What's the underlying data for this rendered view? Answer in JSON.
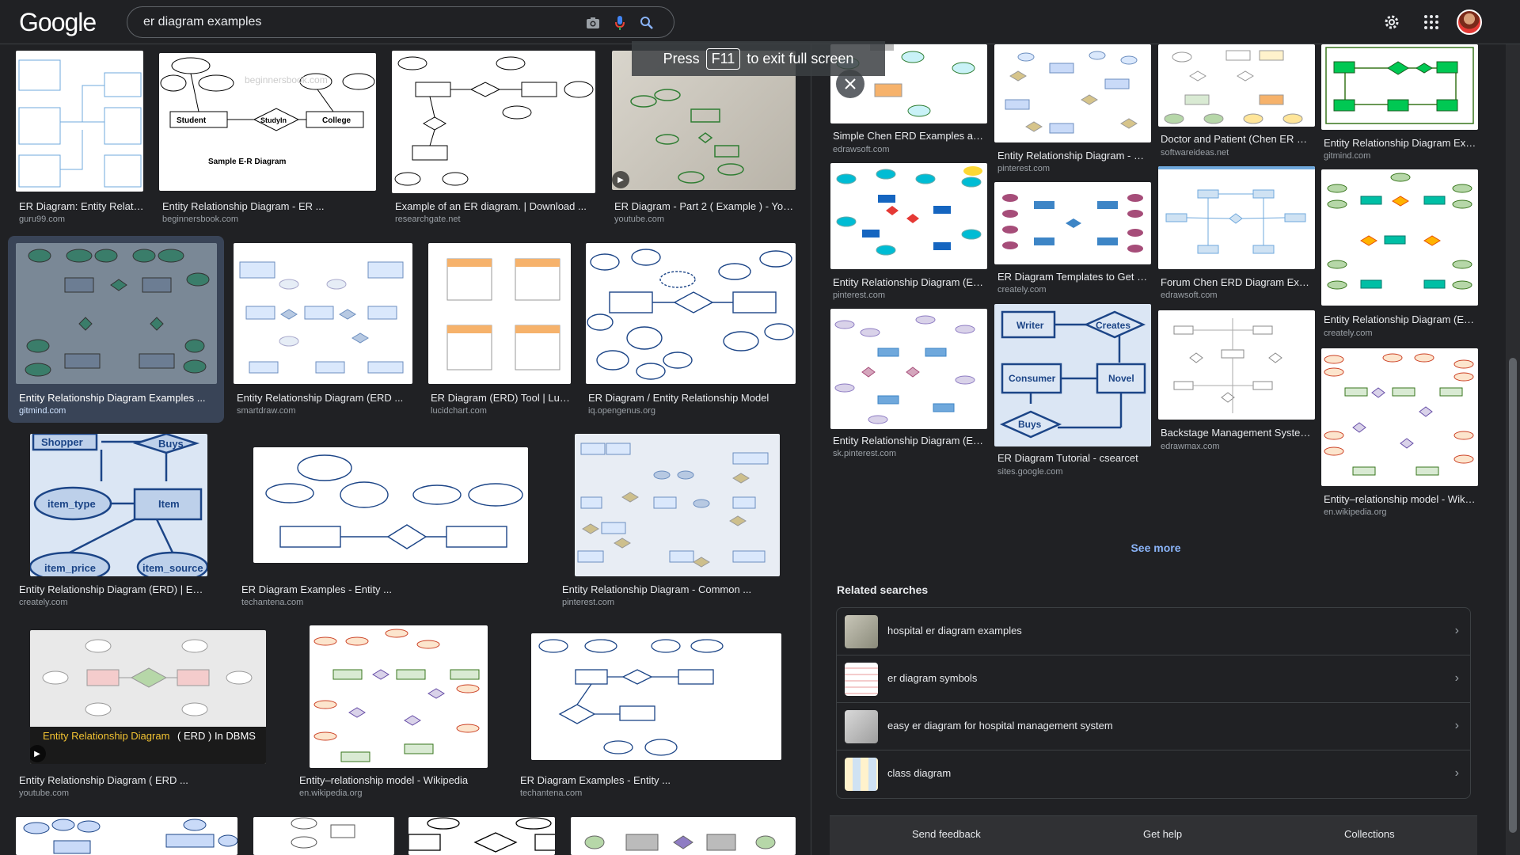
{
  "header": {
    "logo": "Google",
    "query": "er diagram examples"
  },
  "toast": {
    "press": "Press",
    "key": "F11",
    "rest": "to exit full screen"
  },
  "left_results": [
    {
      "caption": "ER Diagram: Entity Relatio...",
      "source": "guru99.com"
    },
    {
      "caption": "Entity Relationship Diagram - ER ...",
      "source": "beginnersbook.com"
    },
    {
      "caption": "Example of an ER diagram. | Download ...",
      "source": "researchgate.net"
    },
    {
      "caption": "ER Diagram - Part 2 ( Example ) - YouTu...",
      "source": "youtube.com"
    },
    {
      "caption": "Entity Relationship Diagram Examples ...",
      "source": "gitmind.com"
    },
    {
      "caption": "Entity Relationship Diagram (ERD ...",
      "source": "smartdraw.com"
    },
    {
      "caption": "ER Diagram (ERD) Tool | Luci...",
      "source": "lucidchart.com"
    },
    {
      "caption": "ER Diagram / Entity Relationship Model",
      "source": "iq.opengenus.org"
    },
    {
      "caption": "Entity Relationship Diagram (ERD) | ER ...",
      "source": "creately.com"
    },
    {
      "caption": "ER Diagram Examples - Entity ...",
      "source": "techantena.com"
    },
    {
      "caption": "Entity Relationship Diagram - Common ...",
      "source": "pinterest.com"
    },
    {
      "caption": "Entity Relationship Diagram ( ERD ...",
      "source": "youtube.com"
    },
    {
      "caption": "Entity–relationship model - Wikipedia",
      "source": "en.wikipedia.org"
    },
    {
      "caption": "ER Diagram Examples - Entity ...",
      "source": "techantena.com"
    }
  ],
  "thumb_text": {
    "sample_er": "Sample E-R Diagram",
    "student": "Student",
    "studyin": "StudyIn",
    "college": "College",
    "shopper": "Shopper",
    "buys": "Buys",
    "item_type": "item_type",
    "item": "Item",
    "item_price": "item_price",
    "item_source": "item_source",
    "dbms_title_a": "Entity Relationship Diagram",
    "dbms_title_b": " ( ERD ) In DBMS",
    "writer": "Writer",
    "creates": "Creates",
    "consumer": "Consumer",
    "novel": "Novel",
    "buys2": "Buys"
  },
  "right_results": [
    {
      "caption": "Simple Chen ERD Examples and ...",
      "source": "edrawsoft.com"
    },
    {
      "caption": "Entity Relationship Diagram - Co...",
      "source": "pinterest.com"
    },
    {
      "caption": "Doctor and Patient (Chen ER Dia...",
      "source": "softwareideas.net"
    },
    {
      "caption": "Entity Relationship Diagram Exa...",
      "source": "gitmind.com"
    },
    {
      "caption": "Entity Relationship Diagram (ERD...",
      "source": "pinterest.com"
    },
    {
      "caption": "ER Diagram Templates to Get St...",
      "source": "creately.com"
    },
    {
      "caption": "Forum Chen ERD Diagram Exam...",
      "source": "edrawsoft.com"
    },
    {
      "caption": "Entity Relationship Diagram (ER...",
      "source": "creately.com"
    },
    {
      "caption": "Entity Relationship Diagram (ERD...",
      "source": "sk.pinterest.com"
    },
    {
      "caption": "ER Diagram Tutorial - csearcet",
      "source": "sites.google.com"
    },
    {
      "caption": "Backstage Management System ...",
      "source": "edrawmax.com"
    },
    {
      "caption": "Entity–relationship model - Wikip...",
      "source": "en.wikipedia.org"
    }
  ],
  "see_more": "See more",
  "related": {
    "title": "Related searches",
    "items": [
      {
        "label": "hospital er diagram examples"
      },
      {
        "label": "er diagram symbols"
      },
      {
        "label": "easy er diagram for hospital management system"
      },
      {
        "label": "class diagram"
      }
    ]
  },
  "footer": {
    "send_feedback": "Send feedback",
    "get_help": "Get help",
    "collections": "Collections"
  },
  "colors": {
    "background": "#202124",
    "selected_tile": "#394457",
    "link": "#8ab4f8"
  },
  "icons": [
    "camera-icon",
    "microphone-icon",
    "search-icon",
    "gear-icon",
    "apps-icon",
    "close-icon",
    "play-icon",
    "chevron-right-icon"
  ]
}
